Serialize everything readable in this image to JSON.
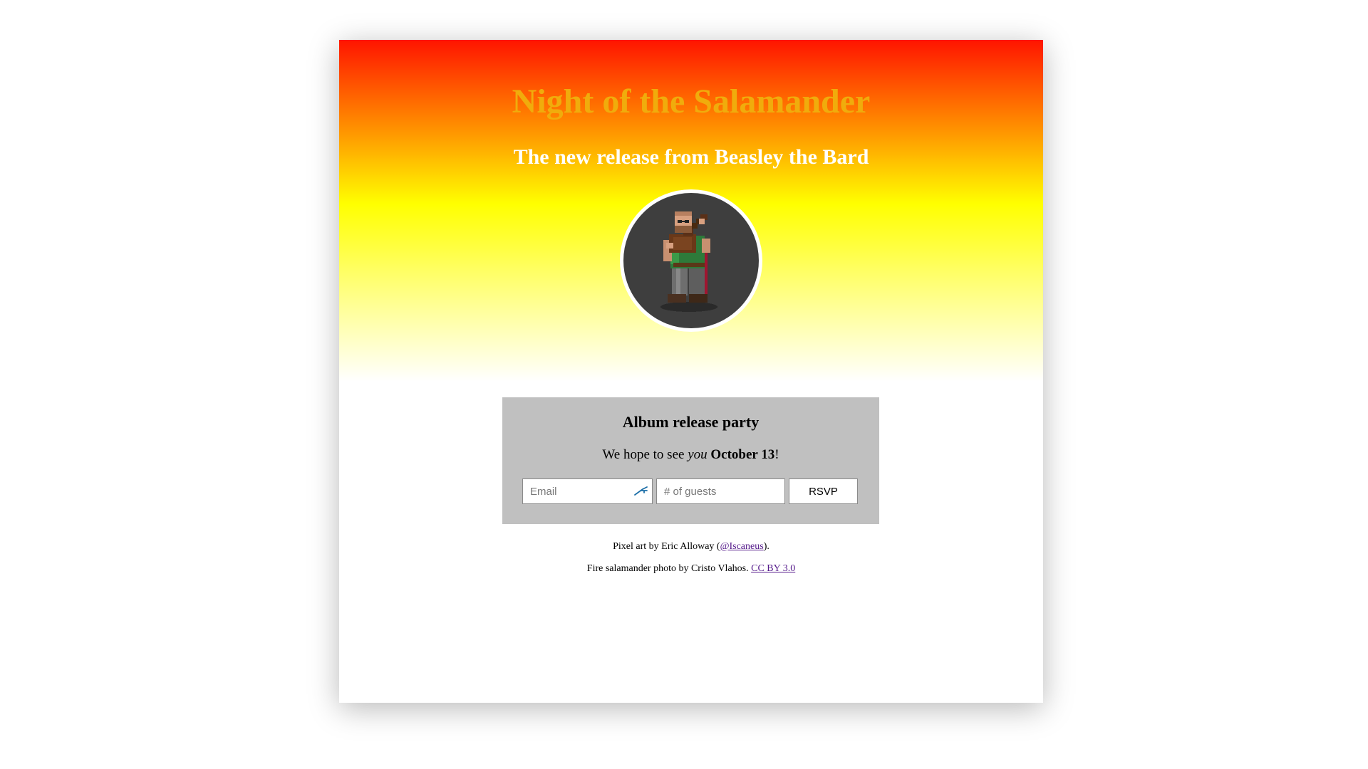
{
  "header": {
    "title": "Night of the Salamander",
    "subtitle": "The new release from Beasley the Bard",
    "avatar_icon": "bard-pixel-art-icon"
  },
  "party": {
    "heading": "Album release party",
    "text_before": "We hope to see ",
    "text_emphasis": "you",
    "text_between": " ",
    "date": "October 13",
    "text_after": "!",
    "email_placeholder": "Email",
    "guests_placeholder": "# of guests",
    "rsvp_label": "RSVP",
    "autofill_icon": "autofill-key-icon"
  },
  "credits": {
    "line1_before": "Pixel art by Eric Alloway (",
    "line1_link": "@Iscaneus",
    "line1_after": ").",
    "line2_before": "Fire salamander photo by Cristo Vlahos. ",
    "line2_link": "CC BY 3.0"
  },
  "colors": {
    "title": "#f0ac0c",
    "gradient_top": "#ff1400",
    "gradient_mid": "#ffff00",
    "card_bg": "#c0c0c0",
    "link": "#551a8b"
  }
}
